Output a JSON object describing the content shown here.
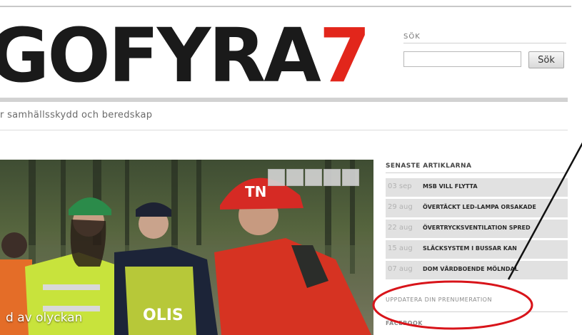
{
  "header": {
    "logo_text": "GOFYRA",
    "logo_number": "7",
    "tagline": "r samhällsskydd och beredskap"
  },
  "search": {
    "label": "SÖK",
    "input_value": "",
    "button_label": "Sök"
  },
  "hero": {
    "caption": "d av olyckan",
    "helmet_text": "TN",
    "thumbnail_count": 5
  },
  "sidebar": {
    "heading": "SENASTE ARTIKLARNA",
    "articles": [
      {
        "date": "03 sep",
        "title": "MSB VILL FLYTTA"
      },
      {
        "date": "29 aug",
        "title": "ÖVERTÄCKT LED-LAMPA ORSAKADE"
      },
      {
        "date": "22 aug",
        "title": "ÖVERTRYCKSVENTILATION SPRED"
      },
      {
        "date": "15 aug",
        "title": "SLÄCKSYSTEM I BUSSAR KAN"
      },
      {
        "date": "07 aug",
        "title": "DOM VÅRDBOENDE MÖLNDAL"
      }
    ],
    "subscribe_link": "UPPDATERA DIN PRENUMERATION",
    "facebook_heading": "FACEBOOK"
  },
  "colors": {
    "logo_accent": "#e2261b",
    "logo_text": "#1a1a1a",
    "annotation": "#d8141a"
  }
}
